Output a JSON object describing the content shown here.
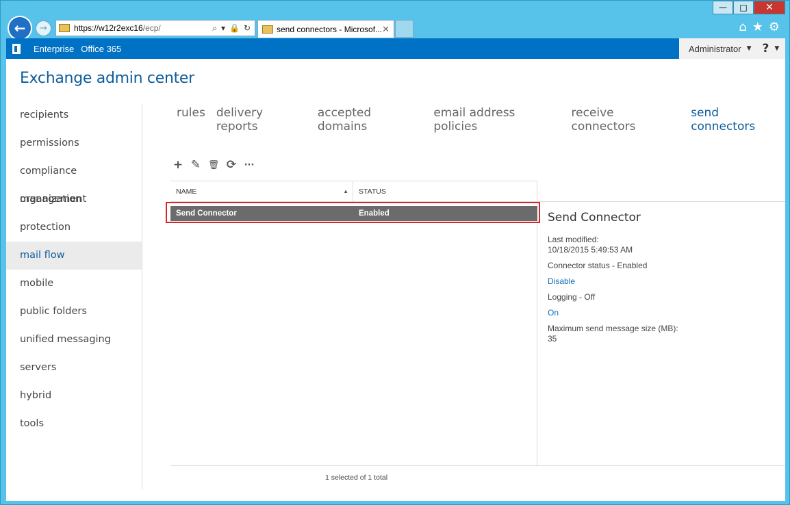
{
  "window": {
    "minimize_label": "—",
    "maximize_label": "□",
    "close_label": "✕"
  },
  "browser": {
    "address_host": "https://w12r2exc16",
    "address_path": "/ecp/",
    "tab_title": "send connectors - Microsof...",
    "tab_close": "✕"
  },
  "topbar": {
    "enterprise": "Enterprise",
    "office365": "Office 365",
    "user": "Administrator",
    "help": "?"
  },
  "app_title": "Exchange admin center",
  "leftnav": [
    {
      "label": "recipients"
    },
    {
      "label": "permissions"
    },
    {
      "label": "compliance management"
    },
    {
      "label": "organization"
    },
    {
      "label": "protection"
    },
    {
      "label": "mail flow",
      "active": true
    },
    {
      "label": "mobile"
    },
    {
      "label": "public folders"
    },
    {
      "label": "unified messaging"
    },
    {
      "label": "servers"
    },
    {
      "label": "hybrid"
    },
    {
      "label": "tools"
    }
  ],
  "subtabs": [
    {
      "label": "rules"
    },
    {
      "label": "delivery reports"
    },
    {
      "label": "accepted domains"
    },
    {
      "label": "email address policies"
    },
    {
      "label": "receive connectors"
    },
    {
      "label": "send connectors",
      "active": true
    }
  ],
  "toolbar": {
    "add": "+",
    "edit": "✎",
    "delete": "🗑",
    "refresh": "⟳",
    "more": "···"
  },
  "list": {
    "col_name": "NAME",
    "col_status": "STATUS",
    "rows": [
      {
        "name": "Send Connector",
        "status": "Enabled",
        "selected": true
      }
    ],
    "footer": "1 selected of 1 total"
  },
  "details": {
    "title": "Send Connector",
    "last_modified_label": "Last modified:",
    "last_modified_value": "10/18/2015 5:49:53 AM",
    "connector_status": "Connector status - Enabled",
    "disable_link": "Disable",
    "logging": "Logging - Off",
    "on_link": "On",
    "max_size_label": "Maximum send message size (MB):",
    "max_size_value": "35"
  },
  "colors": {
    "accent": "#0072c6",
    "title_blue": "#0e5c9a",
    "selected_row": "#6b6b6b",
    "highlight_red": "#d9262c"
  }
}
